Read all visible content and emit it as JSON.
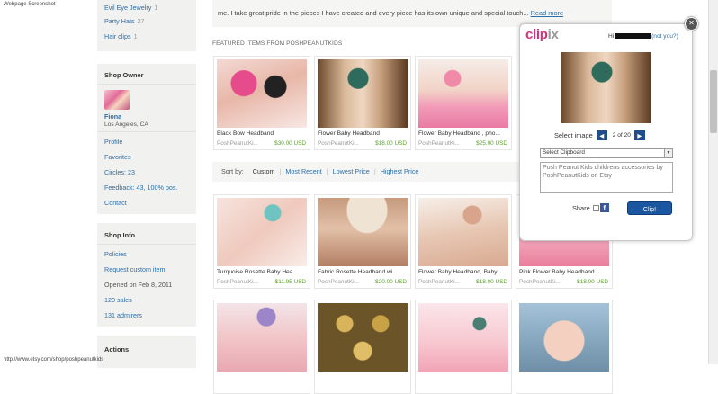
{
  "caption": "Webpage Screenshot",
  "status_url": "http://www.etsy.com/shop/poshpeanutkids",
  "sidebar": {
    "top_links": [
      {
        "label": "Evil Eye Jewelry",
        "count": "1"
      },
      {
        "label": "Party Hats",
        "count": "27"
      },
      {
        "label": "Hair clips",
        "count": "1"
      }
    ],
    "owner": {
      "title": "Shop Owner",
      "name": "Fiona",
      "location": "Los Angeles, CA",
      "links": [
        "Profile",
        "Favorites",
        "Circles: 23",
        "Feedback: 43, 100% pos.",
        "Contact"
      ]
    },
    "info": {
      "title": "Shop Info",
      "policies": "Policies",
      "request": "Request custom item",
      "opened": "Opened on Feb 8, 2011",
      "sales": "120 sales",
      "admirers": "131 admirers"
    },
    "actions_title": "Actions"
  },
  "main": {
    "about_text": "me. I take great pride in the pieces I have created and every piece has its own unique and special touch... ",
    "read_more": "Read more",
    "featured_title": "FEATURED ITEMS FROM POSHPEANUTKIDS",
    "featured": [
      {
        "title": "Black Bow Headband",
        "seller": "PoshPeanutKi...",
        "price": "$30.00 USD"
      },
      {
        "title": "Flower Baby Headband",
        "seller": "PoshPeanutKi...",
        "price": "$18.00 USD"
      },
      {
        "title": "Flower Baby Headband , pho...",
        "seller": "PoshPeanutKi...",
        "price": "$25.00 USD"
      }
    ],
    "sort": {
      "label": "Sort by:",
      "options": [
        "Custom",
        "Most Recent",
        "Lowest Price",
        "Highest Price"
      ]
    },
    "listings": [
      {
        "title": "Turquoise Rosette Baby Hea...",
        "seller": "PoshPeanutKi...",
        "price": "$11.95 USD"
      },
      {
        "title": "Fabric Rosette Headband wi...",
        "seller": "PoshPeanutKi...",
        "price": "$20.00 USD"
      },
      {
        "title": "Flower Baby Headband, Baby...",
        "seller": "PoshPeanutKi...",
        "price": "$18.00 USD"
      },
      {
        "title": "Pink Flower Baby Headband...",
        "seller": "PoshPeanutKi...",
        "price": "$18.00 USD"
      }
    ]
  },
  "clipix": {
    "logo_main": "clip",
    "logo_accent": "ix",
    "greeting": "Hi",
    "not_you": "(not you?)",
    "select_image_label": "Select image",
    "image_counter": "2 of 20",
    "clipboard_placeholder": "Select Clipboard",
    "description": "Posh Peanut Kids childrens accessories by PoshPeanutKids on Etsy",
    "share_label": "Share",
    "clip_button": "Clip!",
    "close_label": "✕"
  },
  "colors": {
    "link": "#2e6ea6",
    "price": "#5aa02c",
    "clipix_brand": "#d4327a",
    "clip_button": "#1a57a0"
  }
}
